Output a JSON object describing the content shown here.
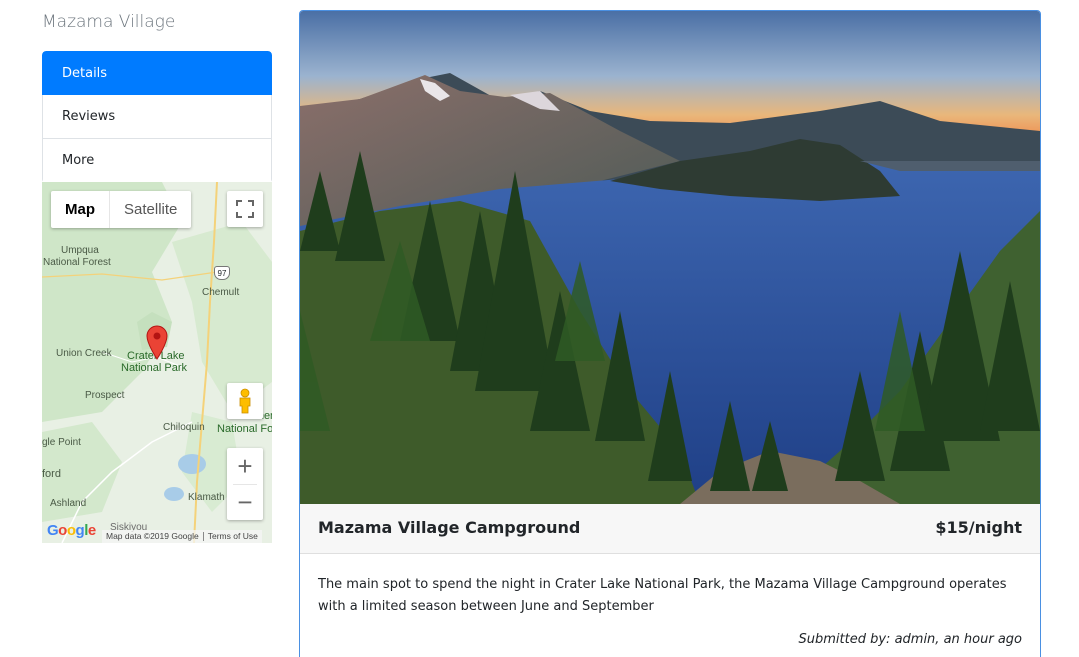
{
  "sidebar": {
    "site_name": "Mazama Village",
    "items": [
      {
        "label": "Details",
        "active": true
      },
      {
        "label": "Reviews",
        "active": false
      },
      {
        "label": "More",
        "active": false
      }
    ]
  },
  "map": {
    "type_options": [
      "Map",
      "Satellite"
    ],
    "selected_type": "Map",
    "labels": {
      "umpqua": "Umpqua",
      "national_forest": "National Forest",
      "chemult": "Chemult",
      "highway": "97",
      "union_creek": "Union Creek",
      "crater_lake_1": "Crater Lake",
      "crater_lake_2": "National Park",
      "prospect": "Prospect",
      "chiloquin": "Chiloquin",
      "winema_1": "Winem",
      "winema_2": "National Fo",
      "eagle_point": "gle Point",
      "medford": "ford",
      "ashland": "Ashland",
      "klamath": "Klamath",
      "siskiyou": "Siskiyou"
    },
    "google_logo": "Google",
    "attribution": "Map data ©2019 Google",
    "terms": "Terms of Use",
    "accent": "#007bff"
  },
  "campground": {
    "name": "Mazama Village Campground",
    "price": "$15/night",
    "description": "The main spot to spend the night in Crater Lake National Park, the Mazama Village Campground operates with a limited season between June and September",
    "submitted_by": "Submitted by: admin, an hour ago"
  }
}
